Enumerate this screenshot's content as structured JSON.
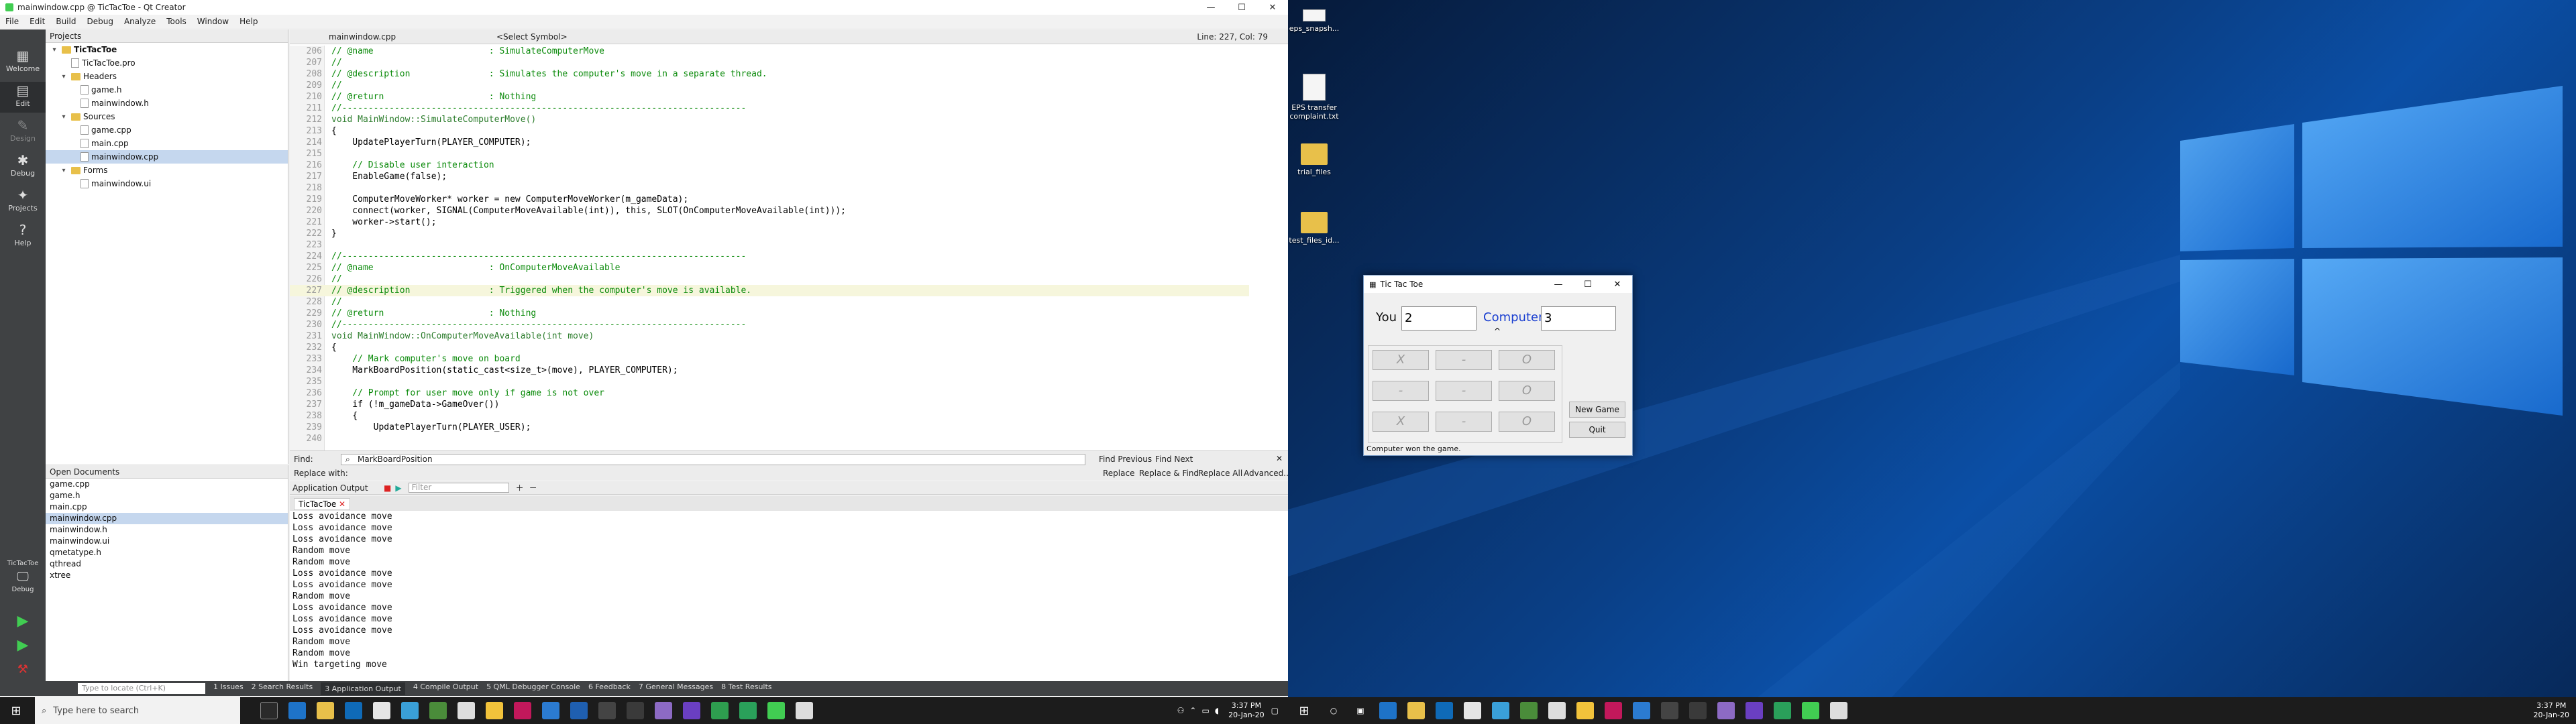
{
  "window": {
    "title": "mainwindow.cpp @ TicTacToe - Qt Creator"
  },
  "menu": [
    "File",
    "Edit",
    "Build",
    "Debug",
    "Analyze",
    "Tools",
    "Window",
    "Help"
  ],
  "modes": [
    {
      "label": "Welcome",
      "icon": "grid-icon"
    },
    {
      "label": "Edit",
      "icon": "edit-icon"
    },
    {
      "label": "Design",
      "icon": "pen-icon"
    },
    {
      "label": "Debug",
      "icon": "bug-icon"
    },
    {
      "label": "Projects",
      "icon": "wrench-icon"
    },
    {
      "label": "Help",
      "icon": "help-icon"
    }
  ],
  "kit": {
    "project": "TicTacToe",
    "mode": "Debug"
  },
  "projects": {
    "header": "Projects",
    "tree": [
      {
        "label": "TicTacToe",
        "indent": 0,
        "kind": "project"
      },
      {
        "label": "TicTacToe.pro",
        "indent": 2,
        "kind": "file"
      },
      {
        "label": "Headers",
        "indent": 1,
        "kind": "folder"
      },
      {
        "label": "game.h",
        "indent": 3,
        "kind": "file"
      },
      {
        "label": "mainwindow.h",
        "indent": 3,
        "kind": "file"
      },
      {
        "label": "Sources",
        "indent": 1,
        "kind": "folder"
      },
      {
        "label": "game.cpp",
        "indent": 3,
        "kind": "file"
      },
      {
        "label": "main.cpp",
        "indent": 3,
        "kind": "file"
      },
      {
        "label": "mainwindow.cpp",
        "indent": 3,
        "kind": "file",
        "selected": true
      },
      {
        "label": "Forms",
        "indent": 1,
        "kind": "folder"
      },
      {
        "label": "mainwindow.ui",
        "indent": 3,
        "kind": "file"
      }
    ]
  },
  "open_documents": {
    "header": "Open Documents",
    "items": [
      "game.cpp",
      "game.h",
      "main.cpp",
      "mainwindow.cpp",
      "mainwindow.h",
      "mainwindow.ui",
      "qmetatype.h",
      "qthread",
      "xtree"
    ],
    "selected": "mainwindow.cpp"
  },
  "editor": {
    "file": "mainwindow.cpp",
    "symbol": "<Select Symbol>",
    "position": "Line: 227, Col: 79",
    "lines": [
      {
        "n": "206",
        "t": "// @name                      : SimulateComputerMove",
        "c": "com"
      },
      {
        "n": "207",
        "t": "//",
        "c": "com"
      },
      {
        "n": "208",
        "t": "// @description               : Simulates the computer's move in a separate thread.",
        "c": "com"
      },
      {
        "n": "209",
        "t": "//",
        "c": "com"
      },
      {
        "n": "210",
        "t": "// @return                    : Nothing",
        "c": "com"
      },
      {
        "n": "211",
        "t": "//-----------------------------------------------------------------------------",
        "c": "com"
      },
      {
        "n": "212",
        "t": "void MainWindow::SimulateComputerMove()",
        "c": "def"
      },
      {
        "n": "213",
        "t": "{",
        "c": ""
      },
      {
        "n": "214",
        "t": "    UpdatePlayerTurn(PLAYER_COMPUTER);",
        "c": ""
      },
      {
        "n": "215",
        "t": "",
        "c": ""
      },
      {
        "n": "216",
        "t": "    // Disable user interaction",
        "c": "com"
      },
      {
        "n": "217",
        "t": "    EnableGame(false);",
        "c": ""
      },
      {
        "n": "218",
        "t": "",
        "c": ""
      },
      {
        "n": "219",
        "t": "    ComputerMoveWorker* worker = new ComputerMoveWorker(m_gameData);",
        "c": ""
      },
      {
        "n": "220",
        "t": "    connect(worker, SIGNAL(ComputerMoveAvailable(int)), this, SLOT(OnComputerMoveAvailable(int)));",
        "c": ""
      },
      {
        "n": "221",
        "t": "    worker->start();",
        "c": ""
      },
      {
        "n": "222",
        "t": "}",
        "c": ""
      },
      {
        "n": "223",
        "t": "",
        "c": ""
      },
      {
        "n": "224",
        "t": "//-----------------------------------------------------------------------------",
        "c": "com"
      },
      {
        "n": "225",
        "t": "// @name                      : OnComputerMoveAvailable",
        "c": "com"
      },
      {
        "n": "226",
        "t": "//",
        "c": "com"
      },
      {
        "n": "227",
        "t": "// @description               : Triggered when the computer's move is available.",
        "c": "com",
        "current": true
      },
      {
        "n": "228",
        "t": "//",
        "c": "com"
      },
      {
        "n": "229",
        "t": "// @return                    : Nothing",
        "c": "com"
      },
      {
        "n": "230",
        "t": "//-----------------------------------------------------------------------------",
        "c": "com"
      },
      {
        "n": "231",
        "t": "void MainWindow::OnComputerMoveAvailable(int move)",
        "c": "def"
      },
      {
        "n": "232",
        "t": "{",
        "c": ""
      },
      {
        "n": "233",
        "t": "    // Mark computer's move on board",
        "c": "com"
      },
      {
        "n": "234",
        "t": "    MarkBoardPosition(static_cast<size_t>(move), PLAYER_COMPUTER);",
        "c": ""
      },
      {
        "n": "235",
        "t": "",
        "c": ""
      },
      {
        "n": "236",
        "t": "    // Prompt for user move only if game is not over",
        "c": "com"
      },
      {
        "n": "237",
        "t": "    if (!m_gameData->GameOver())",
        "c": ""
      },
      {
        "n": "238",
        "t": "    {",
        "c": ""
      },
      {
        "n": "239",
        "t": "        UpdatePlayerTurn(PLAYER_USER);",
        "c": ""
      },
      {
        "n": "240",
        "t": "",
        "c": ""
      }
    ]
  },
  "find": {
    "find_label": "Find:",
    "replace_label": "Replace with:",
    "value": "MarkBoardPosition",
    "find_previous": "Find Previous",
    "find_next": "Find Next",
    "replace": "Replace",
    "replace_find": "Replace & Find",
    "replace_all": "Replace All",
    "advanced": "Advanced..."
  },
  "output": {
    "title": "Application Output",
    "filter_placeholder": "Filter",
    "tab": "TicTacToe",
    "lines": [
      "Loss avoidance move",
      "Loss avoidance move",
      "Loss avoidance move",
      "Random move",
      "Random move",
      "Loss avoidance move",
      "Loss avoidance move",
      "Random move",
      "Loss avoidance move",
      "Loss avoidance move",
      "Loss avoidance move",
      "Random move",
      "Random move",
      "Win targeting move"
    ]
  },
  "statusbar": {
    "locate_placeholder": "Type to locate (Ctrl+K)",
    "tabs": [
      "1 Issues",
      "2 Search Results",
      "3 Application Output",
      "4 Compile Output",
      "5 QML Debugger Console",
      "6 Feedback",
      "7 General Messages",
      "8 Test Results"
    ],
    "active": "3 Application Output"
  },
  "taskbar_left": {
    "search_placeholder": "Type here to search",
    "time": "3:37 PM",
    "date": "20-Jan-20"
  },
  "taskbar_right": {
    "time": "3:37 PM",
    "date": "20-Jan-20"
  },
  "desktop_icons": [
    {
      "label": "eps_snapsh...",
      "kind": "file"
    },
    {
      "label": "EPS transfer complaint.txt",
      "kind": "file"
    },
    {
      "label": "trial_files",
      "kind": "folder"
    },
    {
      "label": "test_files_id...",
      "kind": "folder"
    }
  ],
  "tictactoe": {
    "title": "Tic Tac Toe",
    "you_label": "You",
    "you_score": "2",
    "computer_label": "Computer",
    "computer_score": "3",
    "board": [
      "X",
      "-",
      "O",
      "-",
      "-",
      "O",
      "X",
      "-",
      "O"
    ],
    "new_game": "New Game",
    "quit": "Quit",
    "status": "Computer won the game."
  }
}
